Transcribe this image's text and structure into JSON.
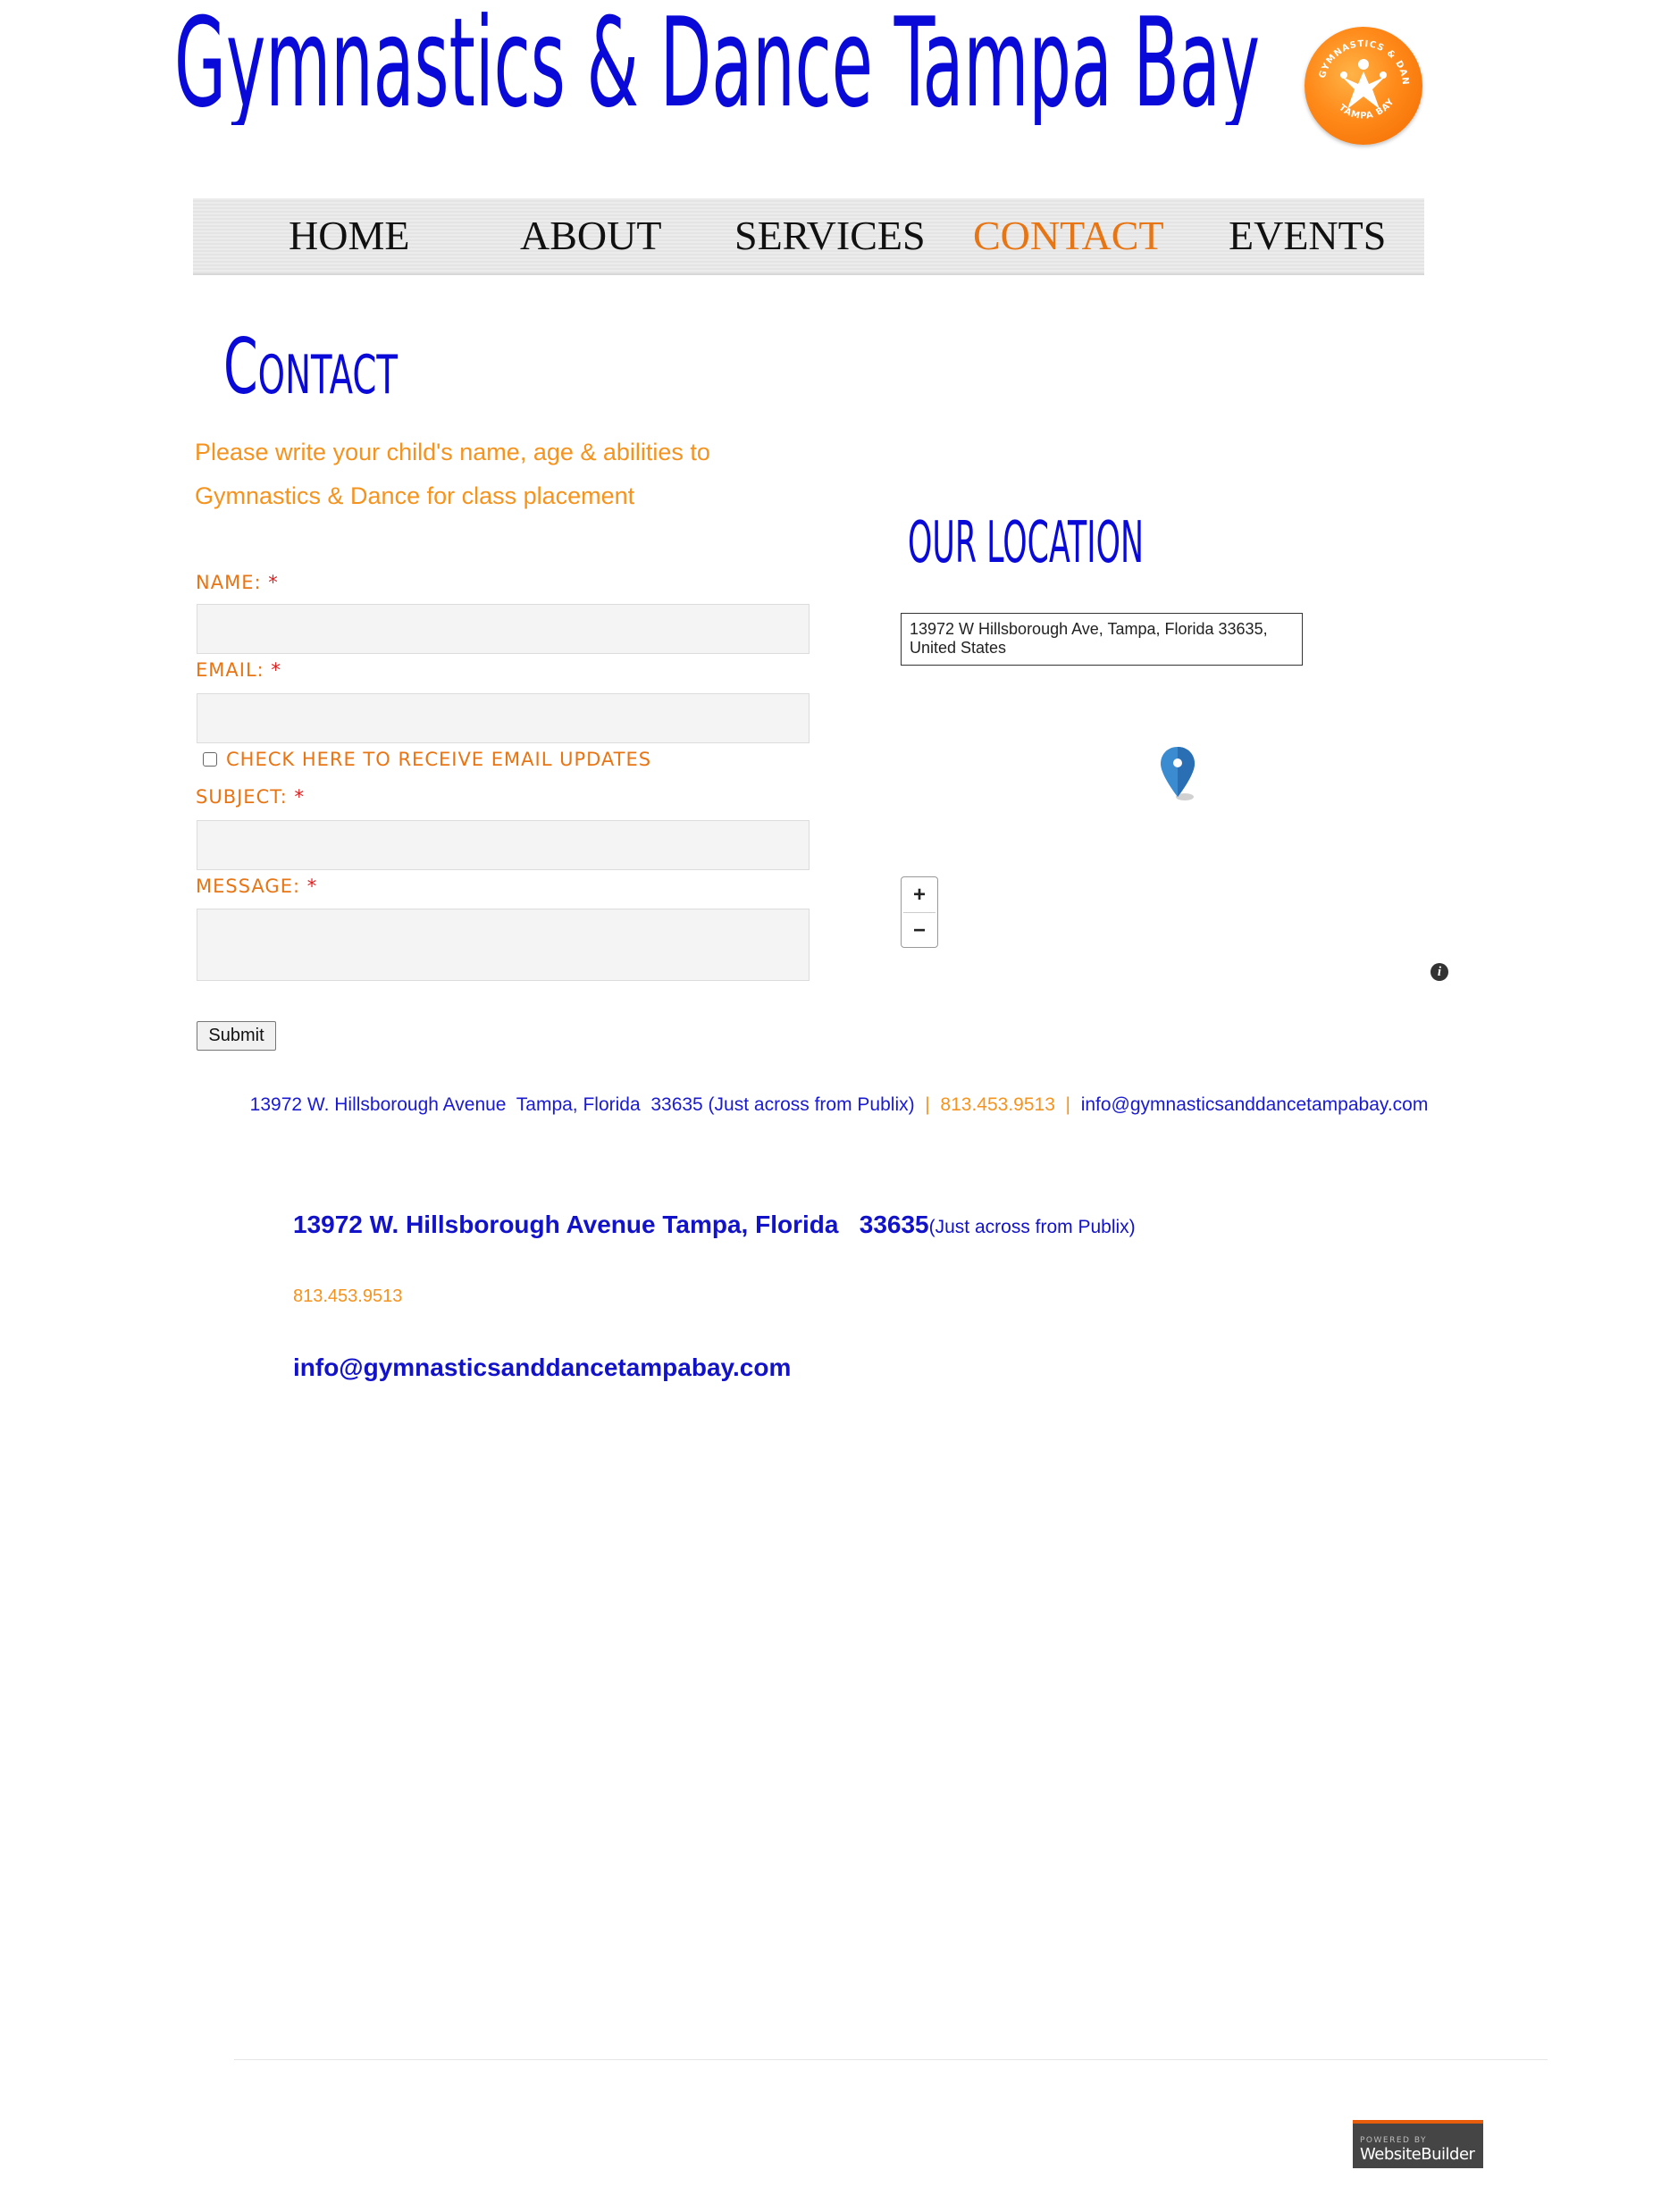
{
  "header": {
    "site_title": "Gymnastics & Dance Tampa Bay",
    "logo_text_top": "GYMNASTICS & DANCE",
    "logo_text_bottom": "TAMPA BAY"
  },
  "nav": {
    "items": [
      {
        "label": "HOME"
      },
      {
        "label": "ABOUT"
      },
      {
        "label": "SERVICES"
      },
      {
        "label": "CONTACT"
      },
      {
        "label": "EVENTS"
      }
    ],
    "active": "CONTACT"
  },
  "main": {
    "heading": "Contact",
    "intro_line1": "Please write your child's name, age & abilities to",
    "intro_line2": "Gymnastics & Dance for class placement"
  },
  "form": {
    "name_label": "NAME:",
    "email_label": "EMAIL:",
    "checkbox_label": "CHECK HERE TO RECEIVE EMAIL UPDATES",
    "subject_label": "SUBJECT:",
    "message_label": "MESSAGE:",
    "required_mark": "*",
    "name_value": "",
    "email_value": "",
    "subject_value": "",
    "message_value": "",
    "submit_label": "Submit"
  },
  "location": {
    "heading": "OUR LOCATION",
    "map_address_line1": "13972 W Hillsborough Ave, Tampa, Florida 33635,",
    "map_address_line2": "United States",
    "zoom_in": "+",
    "zoom_out": "−",
    "info": "i"
  },
  "footer": {
    "address": "13972 W. Hillsborough Avenue  Tampa, Florida  33635 (Just across from Publix)",
    "separator": "  |  ",
    "phone": "813.453.9513",
    "email": "info@gymnasticsanddancetampabay.com"
  },
  "contact_block": {
    "address_main": "13972 W. Hillsborough Avenue Tampa, Florida   33635",
    "address_note": "(Just across from Publix)",
    "phone": "813.453.9513",
    "email": "info@gymnasticsanddancetampabay.com"
  },
  "badge": {
    "powered_by": "POWERED BY",
    "brand": "WebsiteBuilder"
  },
  "colors": {
    "title_blue": "#0a0ad8",
    "accent_orange": "#e87514",
    "light_orange": "#f5931f"
  }
}
